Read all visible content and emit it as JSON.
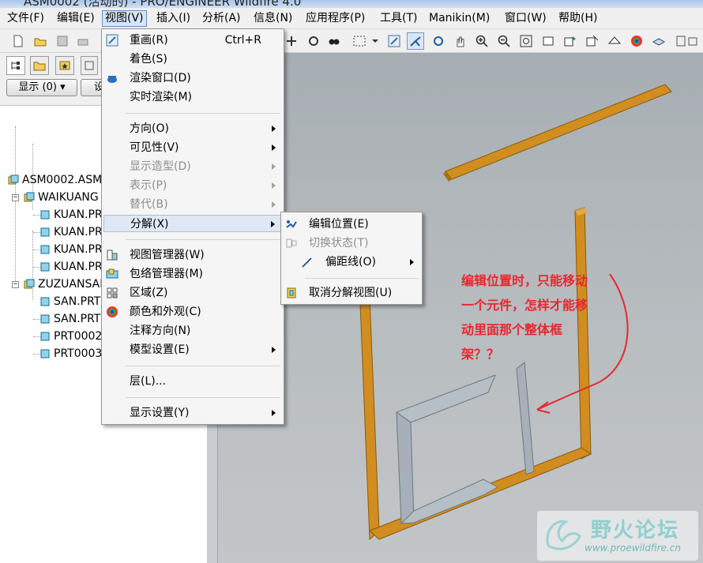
{
  "window": {
    "title": "ASM0002 (活动的) - PRO/ENGINEER Wildfire 4.0"
  },
  "menubar": [
    {
      "label": "文件(F)"
    },
    {
      "label": "编辑(E)"
    },
    {
      "label": "视图(V)"
    },
    {
      "label": "插入(I)"
    },
    {
      "label": "分析(A)"
    },
    {
      "label": "信息(N)"
    },
    {
      "label": "应用程序(P)"
    },
    {
      "label": "工具(T)"
    },
    {
      "label": "Manikin(M)"
    },
    {
      "label": "窗口(W)"
    },
    {
      "label": "帮助(H)"
    }
  ],
  "panel": {
    "show_button": "显示 (0) ▾",
    "settings_button": "设"
  },
  "tree": [
    {
      "label": "ASM0002.ASM"
    },
    {
      "label": "WAIKUANG"
    },
    {
      "label": "KUAN.PRT"
    },
    {
      "label": "KUAN.PRT"
    },
    {
      "label": "KUAN.PRT"
    },
    {
      "label": "KUAN.PRT"
    },
    {
      "label": "ZUZUANSAN"
    },
    {
      "label": "SAN.PRT"
    },
    {
      "label": "SAN.PRT"
    },
    {
      "label": "PRT0002"
    },
    {
      "label": "PRT0003"
    }
  ],
  "view_menu": {
    "items": [
      {
        "label": "重画(R)",
        "shortcut": "Ctrl+R",
        "icon": "repaint-icon"
      },
      {
        "label": "着色(S)",
        "icon": ""
      },
      {
        "label": "渲染窗口(D)",
        "icon": "render-window-icon"
      },
      {
        "label": "实时渲染(M)",
        "icon": ""
      },
      {
        "label": "方向(O)",
        "submenu": true
      },
      {
        "label": "可见性(V)",
        "submenu": true
      },
      {
        "label": "显示造型(D)",
        "submenu": true,
        "disabled": true
      },
      {
        "label": "表示(P)",
        "submenu": true,
        "disabled": true
      },
      {
        "label": "替代(B)",
        "submenu": true,
        "disabled": true
      },
      {
        "label": "分解(X)",
        "submenu": true,
        "highlighted": true
      },
      {
        "label": "视图管理器(W)",
        "icon": "view-manager-icon"
      },
      {
        "label": "包络管理器(M)",
        "icon": "envelope-manager-icon"
      },
      {
        "label": "区域(Z)",
        "icon": "zone-icon"
      },
      {
        "label": "颜色和外观(C)",
        "icon": "color-appearance-icon"
      },
      {
        "label": "注释方向(N)"
      },
      {
        "label": "模型设置(E)",
        "submenu": true
      },
      {
        "label": "层(L)..."
      },
      {
        "label": "显示设置(Y)",
        "submenu": true
      }
    ]
  },
  "explode_menu": {
    "items": [
      {
        "label": "编辑位置(E)",
        "icon": "edit-position-icon"
      },
      {
        "label": "切换状态(T)",
        "icon": "toggle-state-icon",
        "disabled": true
      },
      {
        "label": "偏距线(O)",
        "icon": "offset-line-icon",
        "submenu": true
      },
      {
        "label": "取消分解视图(U)",
        "icon": "unexplode-view-icon"
      }
    ]
  },
  "annotation": {
    "lines": [
      "编辑位置时，只能移动",
      "一个元件，怎样才能移",
      "动里面那个整体框",
      "架？？"
    ],
    "color": "#e8272e"
  },
  "watermark": {
    "title": "野火论坛",
    "url": "www.proewildfire.cn"
  },
  "colors": {
    "frame": "#d18d1f",
    "inner_part": "#b6bec6",
    "viewport": "#b2b8bc"
  }
}
